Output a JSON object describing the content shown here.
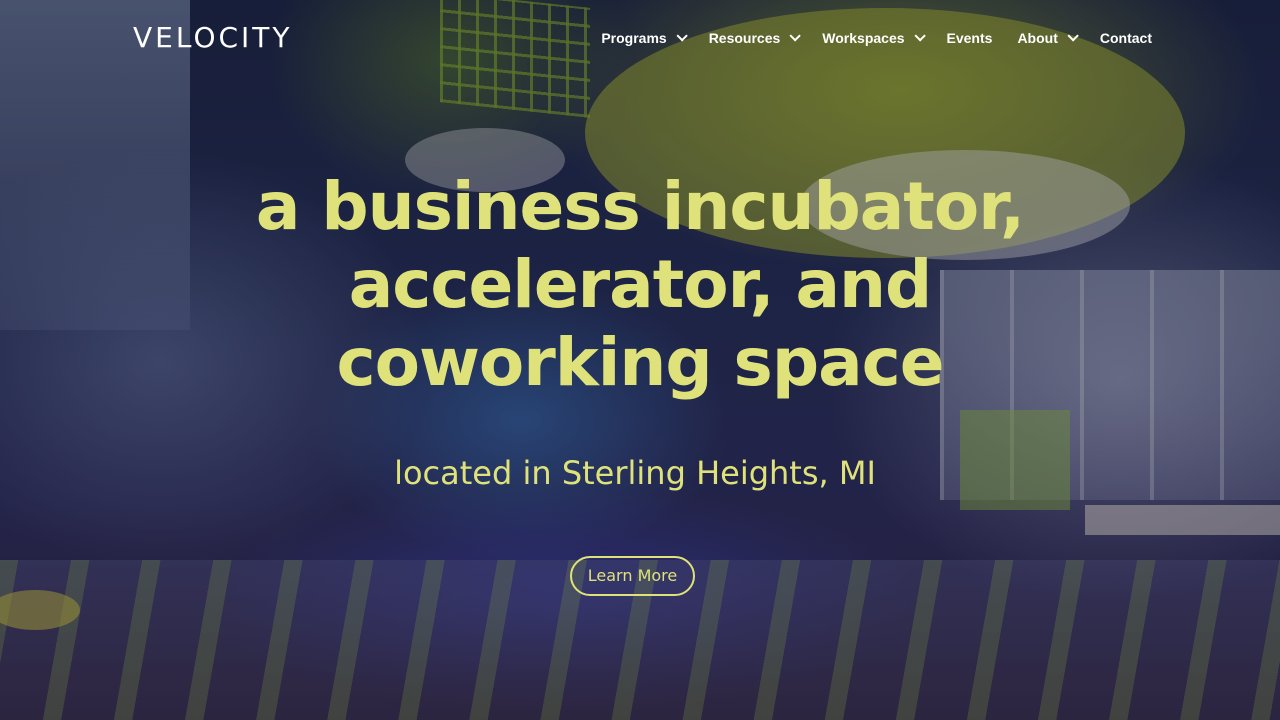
{
  "brand": {
    "logo_text": "VELOCITY",
    "accent_color": "#dfe27a"
  },
  "nav": {
    "items": [
      {
        "label": "Programs",
        "has_dropdown": true
      },
      {
        "label": "Resources",
        "has_dropdown": true
      },
      {
        "label": "Workspaces",
        "has_dropdown": true
      },
      {
        "label": "Events",
        "has_dropdown": false
      },
      {
        "label": "About",
        "has_dropdown": true
      },
      {
        "label": "Contact",
        "has_dropdown": false
      }
    ],
    "dropdown_icon": "chevron-down-icon"
  },
  "hero": {
    "headline_line1": "a business incubator,",
    "headline_line2": "accelerator, and",
    "headline_line3": "coworking space",
    "subheadline": "located in Sterling Heights, MI",
    "cta_label": "Learn More"
  }
}
